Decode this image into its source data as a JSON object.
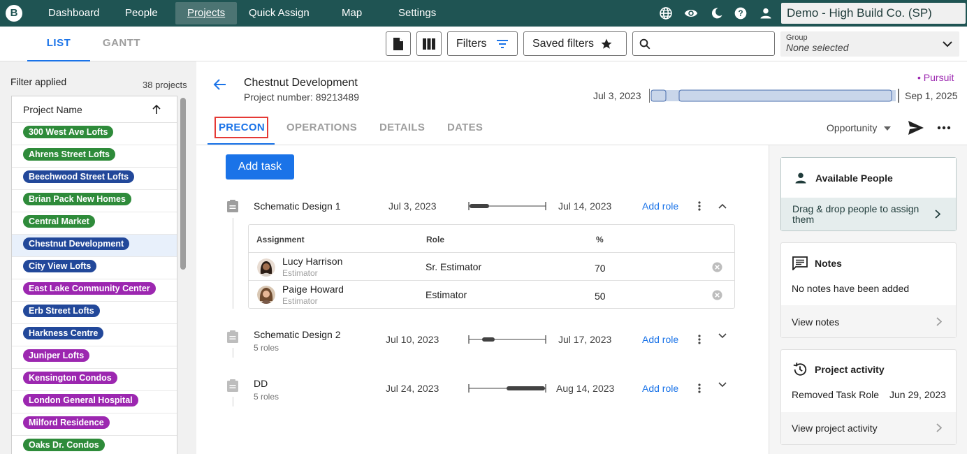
{
  "topnav": {
    "logo": "B",
    "items": [
      "Dashboard",
      "People",
      "Projects",
      "Quick Assign",
      "Map",
      "Settings"
    ],
    "active": "Projects",
    "account": "Demo - High Build Co. (SP)",
    "icons": [
      "globe-icon",
      "eye-icon",
      "moon-icon",
      "help-icon",
      "person-icon"
    ]
  },
  "subbar": {
    "tabs": [
      "LIST",
      "GANTT"
    ],
    "active_tab": "LIST",
    "filters_label": "Filters",
    "saved_filters_label": "Saved filters",
    "search_placeholder": "",
    "group_label": "Group",
    "group_value": "None selected"
  },
  "sidebar": {
    "filter_applied": "Filter applied",
    "project_count": "38 projects",
    "column_header": "Project Name",
    "projects": [
      {
        "name": "300 West Ave Lofts",
        "color": "#2e8b3a"
      },
      {
        "name": "Ahrens Street Lofts",
        "color": "#2e8b3a"
      },
      {
        "name": "Beechwood Street Lofts",
        "color": "#22489a"
      },
      {
        "name": "Brian Pack New Homes",
        "color": "#2e8b3a"
      },
      {
        "name": "Central Market",
        "color": "#2e8b3a"
      },
      {
        "name": "Chestnut Development",
        "color": "#22489a"
      },
      {
        "name": "City View Lofts",
        "color": "#22489a"
      },
      {
        "name": "East Lake Community Center",
        "color": "#9c27b0"
      },
      {
        "name": "Erb Street Lofts",
        "color": "#22489a"
      },
      {
        "name": "Harkness Centre",
        "color": "#22489a"
      },
      {
        "name": "Juniper Lofts",
        "color": "#9c27b0"
      },
      {
        "name": "Kensington Condos",
        "color": "#9c27b0"
      },
      {
        "name": "London General Hospital",
        "color": "#9c27b0"
      },
      {
        "name": "Milford Residence",
        "color": "#9c27b0"
      },
      {
        "name": "Oaks Dr. Condos",
        "color": "#2e8b3a"
      }
    ],
    "selected_index": 5
  },
  "project": {
    "title": "Chestnut Development",
    "number": "Project number: 89213489",
    "status": "• Pursuit",
    "start_date": "Jul 3, 2023",
    "end_date": "Sep 1, 2025",
    "tabs": [
      "PRECON",
      "OPERATIONS",
      "DETAILS",
      "DATES"
    ],
    "active_tab": "PRECON",
    "stage": "Opportunity",
    "add_task_label": "Add task"
  },
  "tasks": [
    {
      "name": "Schematic Design 1",
      "sub": "",
      "start": "Jul 3, 2023",
      "end": "Jul 14, 2023",
      "add_role": "Add role",
      "expanded": true,
      "assignments_header": [
        "Assignment",
        "Role",
        "%"
      ],
      "assignments": [
        {
          "name": "Lucy Harrison",
          "title": "Estimator",
          "role": "Sr. Estimator",
          "pct": "70"
        },
        {
          "name": "Paige Howard",
          "title": "Estimator",
          "role": "Estimator",
          "pct": "50"
        }
      ]
    },
    {
      "name": "Schematic Design 2",
      "sub": "5 roles",
      "start": "Jul 10, 2023",
      "end": "Jul 17, 2023",
      "add_role": "Add role",
      "expanded": false
    },
    {
      "name": "DD",
      "sub": "5 roles",
      "start": "Jul 24, 2023",
      "end": "Aug 14, 2023",
      "add_role": "Add role",
      "expanded": false
    }
  ],
  "right": {
    "available_people": {
      "title": "Available People",
      "text": "Drag & drop people to assign them"
    },
    "notes": {
      "title": "Notes",
      "text": "No notes have been added",
      "link": "View notes"
    },
    "activity": {
      "title": "Project activity",
      "event": "Removed Task Role",
      "event_date": "Jun 29, 2023",
      "link": "View project activity"
    }
  }
}
